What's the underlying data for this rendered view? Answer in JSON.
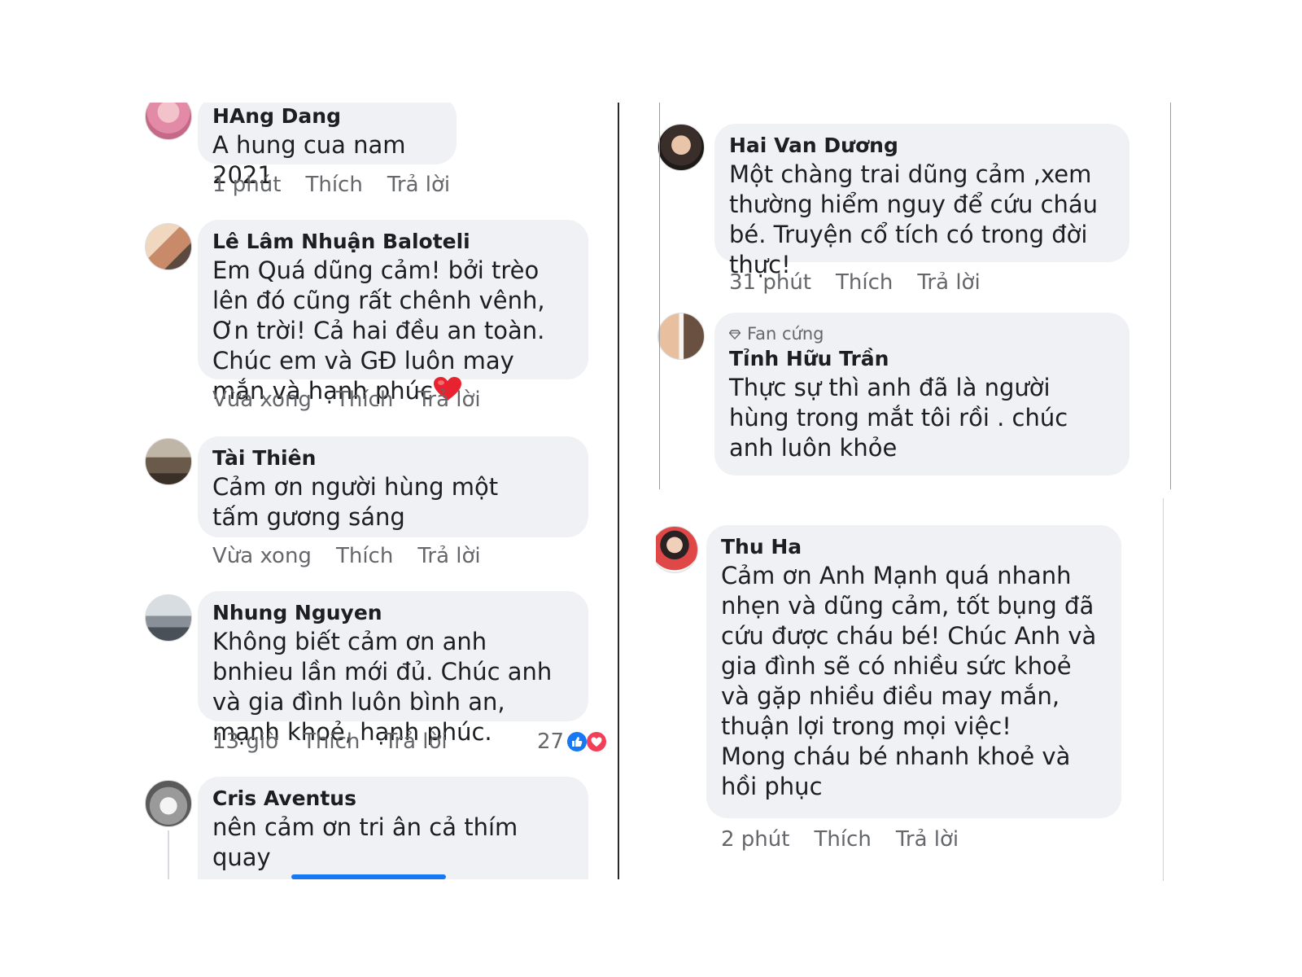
{
  "comments_left": [
    {
      "author": "HAng Dang",
      "text": "A hung cua nam 2021",
      "time": "1 phút",
      "like": "Thích",
      "reply": "Trả lời",
      "avatar_color": "#e8a0b8"
    },
    {
      "author": "Lê Lâm Nhuận Baloteli",
      "text": "Em Quá dũng cảm! bởi trèo lên đó cũng rất chênh vênh, Ơn trời! Cả hai đều an toàn. Chúc em và GĐ luôn may mắn và hạnh phúc",
      "time": "Vừa xong",
      "like": "Thích",
      "reply": "Trả lời",
      "avatar_color": "#c89070"
    },
    {
      "author": "Tài Thiên",
      "text": "Cảm ơn người hùng một tấm gương sáng",
      "time": "Vừa xong",
      "like": "Thích",
      "reply": "Trả lời",
      "avatar_color": "#8a7a6a"
    },
    {
      "author": "Nhung Nguyen",
      "text": "Không biết cảm ơn anh bnhieu lần mới đủ. Chúc anh và gia đình luôn bình an, mạnh khoẻ, hạnh phúc.",
      "time": "13 giờ",
      "like": "Thích",
      "reply": "Trả lời",
      "reaction_count": "27",
      "avatar_color": "#9aa0a8"
    },
    {
      "author": "Cris Aventus",
      "text": "nên cảm ơn tri ân cả thím quay",
      "avatar_color": "#7a7a7a"
    }
  ],
  "comments_right_top": [
    {
      "author": "Hai Van Dương",
      "text": "Một chàng trai dũng cảm ,xem thường hiểm nguy để cứu cháu bé. Truyện cổ tích có trong đời thực!",
      "time": "31 phút",
      "like": "Thích",
      "reply": "Trả lời",
      "avatar_color": "#4a4040"
    },
    {
      "badge": "Fan cứng",
      "author": "Tỉnh Hữu Trần",
      "text": "Thực sự thì anh đã là người hùng trong mắt tôi rồi . chúc anh luôn khỏe",
      "avatar_color": "#b07a60"
    }
  ],
  "comments_right_bottom": [
    {
      "author": "Thu Ha",
      "text": "Cảm ơn Anh Mạnh quá nhanh nhẹn và dũng cảm, tốt bụng đã cứu được cháu bé! Chúc  Anh và gia đình sẽ có nhiều sức khoẻ và gặp nhiều điều may mắn, thuận lợi trong mọi việc!",
      "text2": "Mong cháu bé nhanh khoẻ và hồi phục",
      "time": "2 phút",
      "like": "Thích",
      "reply": "Trả lời",
      "avatar_color": "#d04040"
    }
  ],
  "colors": {
    "bubble": "#eff1f4",
    "meta_text": "#65676b",
    "like_blue": "#1877f2",
    "love_red": "#f33e58"
  }
}
